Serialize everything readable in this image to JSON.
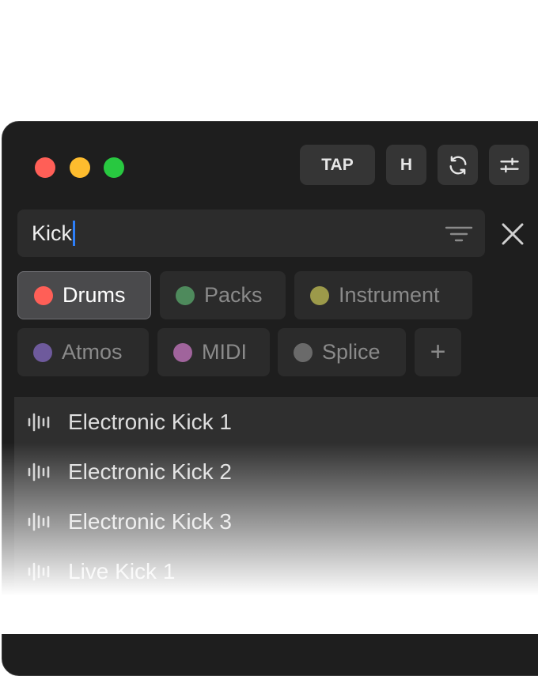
{
  "toolbar": {
    "tap_label": "TAP",
    "h_label": "H"
  },
  "search": {
    "value": "Kick"
  },
  "tags": [
    {
      "label": "Drums",
      "color": "#ff5f57",
      "active": true
    },
    {
      "label": "Packs",
      "color": "#4e8a5c",
      "active": false
    },
    {
      "label": "Instrument",
      "color": "#9c9a4a",
      "active": false
    },
    {
      "label": "Atmos",
      "color": "#6e5a9c",
      "active": false
    },
    {
      "label": "MIDI",
      "color": "#a0649c",
      "active": false
    },
    {
      "label": "Splice",
      "color": "#6a6a6a",
      "active": false
    }
  ],
  "add_tag_label": "+",
  "results": [
    {
      "label": "Electronic Kick 1",
      "icon": "waveform-icon"
    },
    {
      "label": "Electronic Kick 2",
      "icon": "waveform-icon"
    },
    {
      "label": "Electronic Kick 3",
      "icon": "waveform-icon"
    },
    {
      "label": "Live Kick 1",
      "icon": "waveform-icon"
    }
  ]
}
